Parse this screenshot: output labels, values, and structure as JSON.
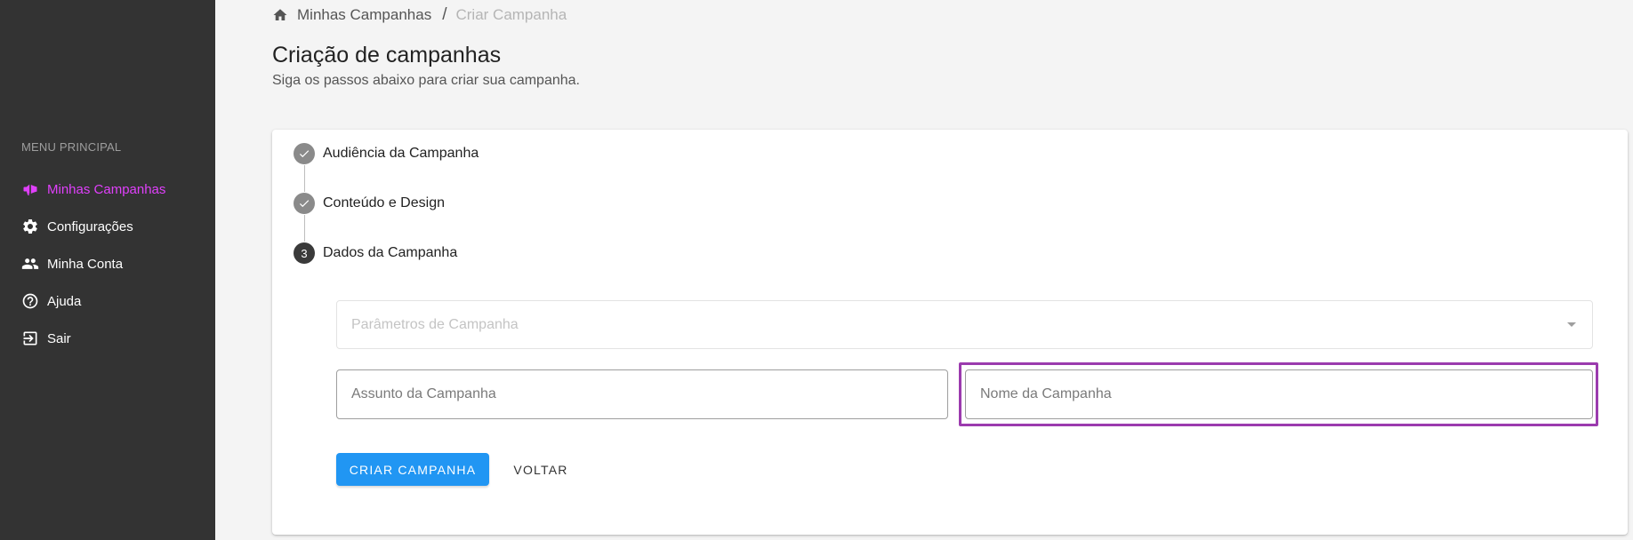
{
  "sidebar": {
    "heading": "MENU PRINCIPAL",
    "items": [
      {
        "label": "Minhas Campanhas",
        "icon": "megaphone-icon",
        "active": true
      },
      {
        "label": "Configurações",
        "icon": "gear-icon",
        "active": false
      },
      {
        "label": "Minha Conta",
        "icon": "people-icon",
        "active": false
      },
      {
        "label": "Ajuda",
        "icon": "help-circle-icon",
        "active": false
      },
      {
        "label": "Sair",
        "icon": "logout-icon",
        "active": false
      }
    ]
  },
  "breadcrumb": {
    "home_icon": "home-icon",
    "items": [
      "Minhas Campanhas",
      "Criar Campanha"
    ],
    "separator": "/"
  },
  "page": {
    "title": "Criação de campanhas",
    "subtitle": "Siga os passos abaixo para criar sua campanha."
  },
  "stepper": {
    "steps": [
      {
        "label": "Audiência da Campanha",
        "status": "done"
      },
      {
        "label": "Conteúdo e Design",
        "status": "done"
      },
      {
        "label": "Dados da Campanha",
        "status": "current",
        "number": "3"
      }
    ]
  },
  "form": {
    "parameters_placeholder": "Parâmetros de Campanha",
    "subject_placeholder": "Assunto da Campanha",
    "subject_value": "",
    "name_placeholder": "Nome da Campanha",
    "name_value": "",
    "create_label": "CRIAR CAMPANHA",
    "back_label": "VOLTAR"
  },
  "colors": {
    "sidebar_bg": "#333333",
    "active_accent": "#e040fb",
    "primary_button": "#2196f3",
    "highlight_border": "#9b3bae"
  }
}
